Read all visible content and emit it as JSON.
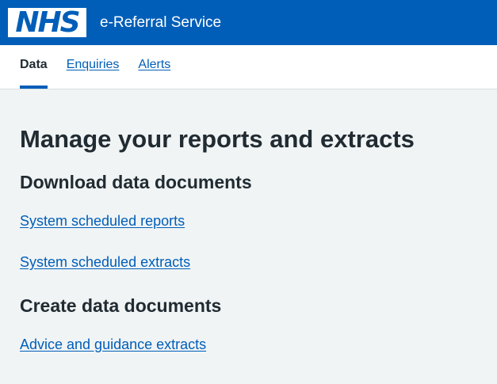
{
  "header": {
    "logo_text": "NHS",
    "service_name": "e-Referral Service"
  },
  "nav": {
    "items": [
      {
        "label": "Data",
        "active": true
      },
      {
        "label": "Enquiries",
        "active": false
      },
      {
        "label": "Alerts",
        "active": false
      }
    ]
  },
  "main": {
    "title": "Manage your reports and extracts",
    "sections": [
      {
        "heading": "Download data documents",
        "links": [
          "System scheduled reports",
          "System scheduled extracts"
        ]
      },
      {
        "heading": "Create data documents",
        "links": [
          "Advice and guidance extracts"
        ]
      }
    ]
  },
  "colors": {
    "brand_blue": "#005eb8",
    "page_background": "#f0f4f5",
    "text": "#212b32"
  }
}
